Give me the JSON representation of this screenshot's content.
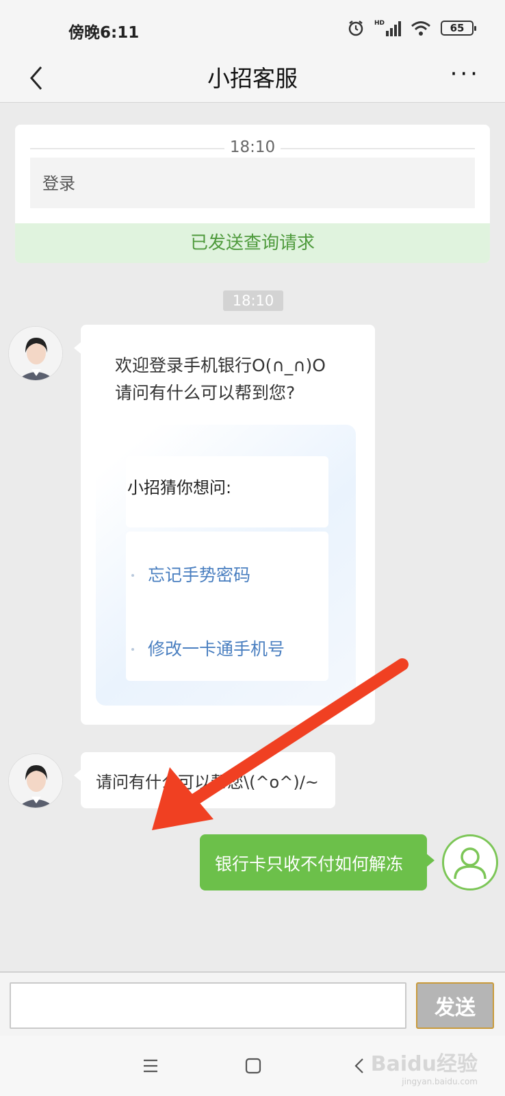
{
  "status_bar": {
    "time": "傍晚6:11",
    "battery": "65",
    "network": "HD"
  },
  "header": {
    "title": "小招客服"
  },
  "query_card": {
    "time": "18:10",
    "login_text": "登录",
    "status": "已发送查询请求"
  },
  "chat": {
    "timestamp": "18:10",
    "welcome": {
      "line1": "欢迎登录手机银行O(∩_∩)O",
      "line2": "请问有什么可以帮到您?"
    },
    "suggestions": {
      "title": "小招猜你想问:",
      "items": [
        "忘记手势密码",
        "修改一卡通手机号"
      ]
    },
    "ask_message": "请问有什么可以帮您\\(^o^)/~",
    "user_message": "银行卡只收不付如何解冻"
  },
  "input": {
    "value": "",
    "send_label": "发送"
  },
  "watermark": {
    "text": "Baidu经验",
    "sub": "jingyan.baidu.com"
  },
  "colors": {
    "accent_green": "#6cc04a",
    "link_blue": "#4a7fc0",
    "arrow_red": "#f04022"
  }
}
